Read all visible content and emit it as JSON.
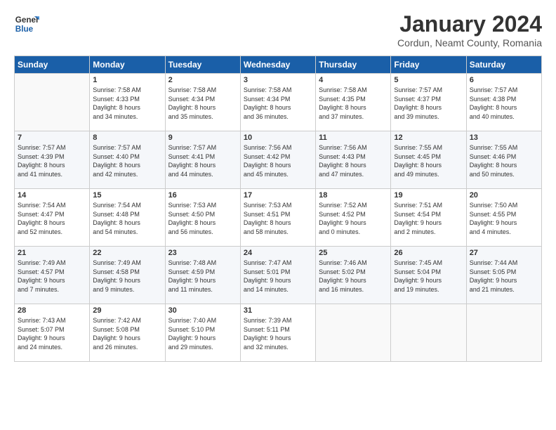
{
  "header": {
    "logo_line1": "General",
    "logo_line2": "Blue",
    "month_title": "January 2024",
    "location": "Cordun, Neamt County, Romania"
  },
  "weekdays": [
    "Sunday",
    "Monday",
    "Tuesday",
    "Wednesday",
    "Thursday",
    "Friday",
    "Saturday"
  ],
  "weeks": [
    [
      {
        "day": "",
        "content": ""
      },
      {
        "day": "1",
        "content": "Sunrise: 7:58 AM\nSunset: 4:33 PM\nDaylight: 8 hours\nand 34 minutes."
      },
      {
        "day": "2",
        "content": "Sunrise: 7:58 AM\nSunset: 4:34 PM\nDaylight: 8 hours\nand 35 minutes."
      },
      {
        "day": "3",
        "content": "Sunrise: 7:58 AM\nSunset: 4:34 PM\nDaylight: 8 hours\nand 36 minutes."
      },
      {
        "day": "4",
        "content": "Sunrise: 7:58 AM\nSunset: 4:35 PM\nDaylight: 8 hours\nand 37 minutes."
      },
      {
        "day": "5",
        "content": "Sunrise: 7:57 AM\nSunset: 4:37 PM\nDaylight: 8 hours\nand 39 minutes."
      },
      {
        "day": "6",
        "content": "Sunrise: 7:57 AM\nSunset: 4:38 PM\nDaylight: 8 hours\nand 40 minutes."
      }
    ],
    [
      {
        "day": "7",
        "content": "Sunrise: 7:57 AM\nSunset: 4:39 PM\nDaylight: 8 hours\nand 41 minutes."
      },
      {
        "day": "8",
        "content": "Sunrise: 7:57 AM\nSunset: 4:40 PM\nDaylight: 8 hours\nand 42 minutes."
      },
      {
        "day": "9",
        "content": "Sunrise: 7:57 AM\nSunset: 4:41 PM\nDaylight: 8 hours\nand 44 minutes."
      },
      {
        "day": "10",
        "content": "Sunrise: 7:56 AM\nSunset: 4:42 PM\nDaylight: 8 hours\nand 45 minutes."
      },
      {
        "day": "11",
        "content": "Sunrise: 7:56 AM\nSunset: 4:43 PM\nDaylight: 8 hours\nand 47 minutes."
      },
      {
        "day": "12",
        "content": "Sunrise: 7:55 AM\nSunset: 4:45 PM\nDaylight: 8 hours\nand 49 minutes."
      },
      {
        "day": "13",
        "content": "Sunrise: 7:55 AM\nSunset: 4:46 PM\nDaylight: 8 hours\nand 50 minutes."
      }
    ],
    [
      {
        "day": "14",
        "content": "Sunrise: 7:54 AM\nSunset: 4:47 PM\nDaylight: 8 hours\nand 52 minutes."
      },
      {
        "day": "15",
        "content": "Sunrise: 7:54 AM\nSunset: 4:48 PM\nDaylight: 8 hours\nand 54 minutes."
      },
      {
        "day": "16",
        "content": "Sunrise: 7:53 AM\nSunset: 4:50 PM\nDaylight: 8 hours\nand 56 minutes."
      },
      {
        "day": "17",
        "content": "Sunrise: 7:53 AM\nSunset: 4:51 PM\nDaylight: 8 hours\nand 58 minutes."
      },
      {
        "day": "18",
        "content": "Sunrise: 7:52 AM\nSunset: 4:52 PM\nDaylight: 9 hours\nand 0 minutes."
      },
      {
        "day": "19",
        "content": "Sunrise: 7:51 AM\nSunset: 4:54 PM\nDaylight: 9 hours\nand 2 minutes."
      },
      {
        "day": "20",
        "content": "Sunrise: 7:50 AM\nSunset: 4:55 PM\nDaylight: 9 hours\nand 4 minutes."
      }
    ],
    [
      {
        "day": "21",
        "content": "Sunrise: 7:49 AM\nSunset: 4:57 PM\nDaylight: 9 hours\nand 7 minutes."
      },
      {
        "day": "22",
        "content": "Sunrise: 7:49 AM\nSunset: 4:58 PM\nDaylight: 9 hours\nand 9 minutes."
      },
      {
        "day": "23",
        "content": "Sunrise: 7:48 AM\nSunset: 4:59 PM\nDaylight: 9 hours\nand 11 minutes."
      },
      {
        "day": "24",
        "content": "Sunrise: 7:47 AM\nSunset: 5:01 PM\nDaylight: 9 hours\nand 14 minutes."
      },
      {
        "day": "25",
        "content": "Sunrise: 7:46 AM\nSunset: 5:02 PM\nDaylight: 9 hours\nand 16 minutes."
      },
      {
        "day": "26",
        "content": "Sunrise: 7:45 AM\nSunset: 5:04 PM\nDaylight: 9 hours\nand 19 minutes."
      },
      {
        "day": "27",
        "content": "Sunrise: 7:44 AM\nSunset: 5:05 PM\nDaylight: 9 hours\nand 21 minutes."
      }
    ],
    [
      {
        "day": "28",
        "content": "Sunrise: 7:43 AM\nSunset: 5:07 PM\nDaylight: 9 hours\nand 24 minutes."
      },
      {
        "day": "29",
        "content": "Sunrise: 7:42 AM\nSunset: 5:08 PM\nDaylight: 9 hours\nand 26 minutes."
      },
      {
        "day": "30",
        "content": "Sunrise: 7:40 AM\nSunset: 5:10 PM\nDaylight: 9 hours\nand 29 minutes."
      },
      {
        "day": "31",
        "content": "Sunrise: 7:39 AM\nSunset: 5:11 PM\nDaylight: 9 hours\nand 32 minutes."
      },
      {
        "day": "",
        "content": ""
      },
      {
        "day": "",
        "content": ""
      },
      {
        "day": "",
        "content": ""
      }
    ]
  ]
}
